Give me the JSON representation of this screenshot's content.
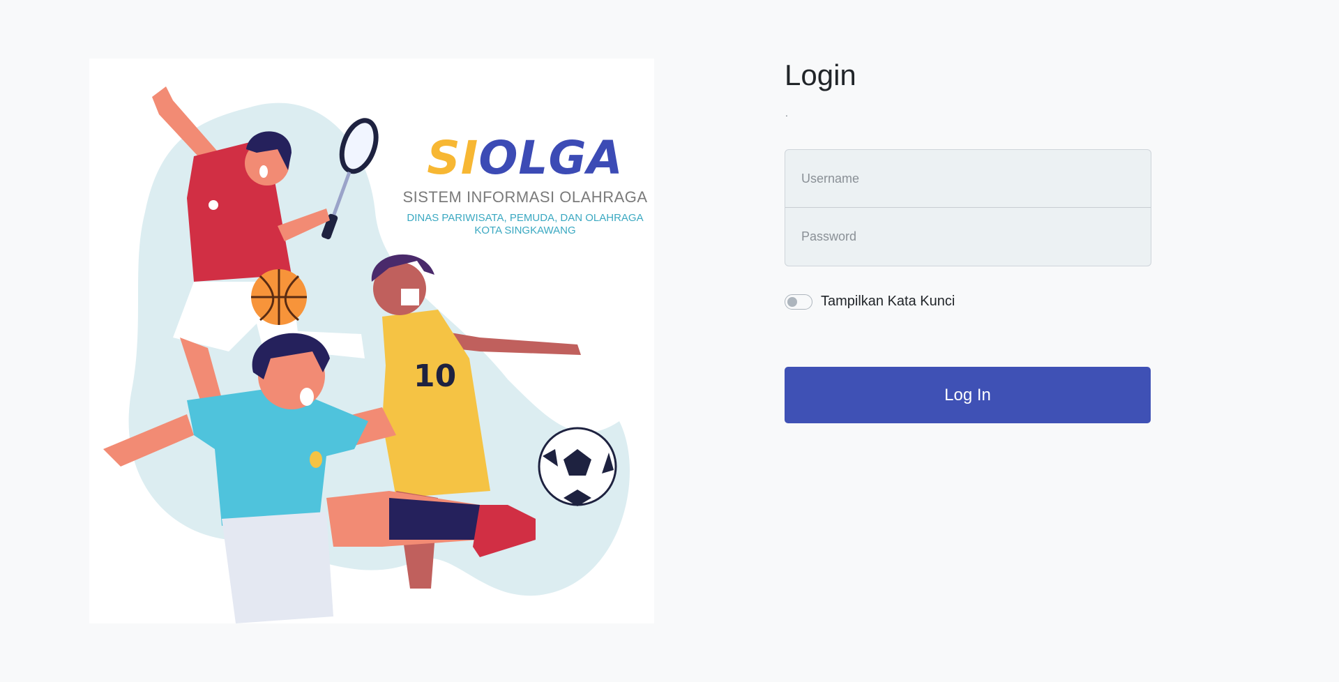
{
  "brand": {
    "logo_si": "SI",
    "logo_olga": "OLGA",
    "subtitle": "SISTEM INFORMASI OLAHRAGA",
    "dept_line1": "DINAS PARIWISATA, PEMUDA, DAN OLAHRAGA",
    "dept_line2": "KOTA SINGKAWANG",
    "jersey_number": "10"
  },
  "login": {
    "title": "Login",
    "subtitle_mark": ".",
    "username_placeholder": "Username",
    "password_placeholder": "Password",
    "show_password_label": "Tampilkan Kata Kunci",
    "show_password_checked": false,
    "submit_label": "Log In"
  },
  "colors": {
    "accent": "#3f51b5",
    "page_bg": "#f8f9fa",
    "logo_yellow": "#f7b733",
    "logo_blue": "#3c4bb5",
    "dept_teal": "#3aa8c1"
  }
}
